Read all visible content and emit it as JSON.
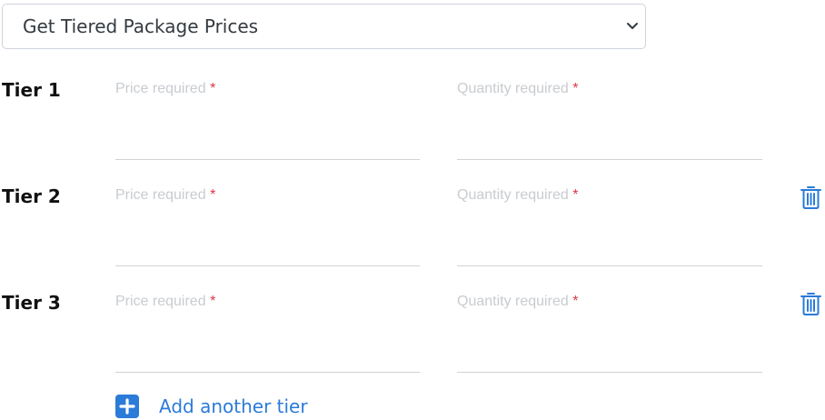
{
  "package_select": {
    "selected": "Get Tiered Package Prices",
    "icon": "chevron-down-icon"
  },
  "tiers": [
    {
      "label": "Tier 1",
      "price_placeholder": "Price required",
      "quantity_placeholder": "Quantity required",
      "required_mark": "*",
      "deletable": false
    },
    {
      "label": "Tier 2",
      "price_placeholder": "Price required",
      "quantity_placeholder": "Quantity required",
      "required_mark": "*",
      "deletable": true
    },
    {
      "label": "Tier 3",
      "price_placeholder": "Price required",
      "quantity_placeholder": "Quantity required",
      "required_mark": "*",
      "deletable": true
    }
  ],
  "add_tier": {
    "label": "Add another tier",
    "icon": "plus-square-icon"
  },
  "colors": {
    "accent": "#2b7bd8",
    "required": "#dc3545",
    "placeholder": "#c8ccd0",
    "border": "#ced4da"
  }
}
